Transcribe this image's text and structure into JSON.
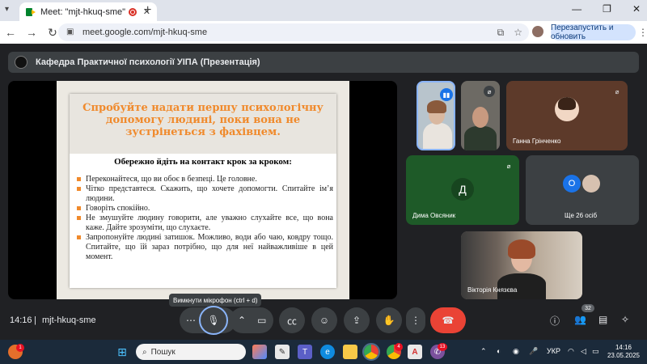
{
  "browser": {
    "tab_title": "Meet: \"mjt-hkuq-sme\"",
    "tab_close": "✕",
    "new_tab": "+",
    "url": "meet.google.com/mjt-hkuq-sme",
    "relaunch_label": "Перезапустить и обновить"
  },
  "meeting": {
    "header_title": "Кафедра Практичної психології УІПА (Презентація)",
    "time": "14:16",
    "code": "mjt-hkuq-sme",
    "mic_tooltip": "Вимкнути мікрофон (ctrl + d)",
    "participants_count": "32"
  },
  "slide": {
    "heading": "Спробуйте надати першу психологічну допомогу людині, поки вона не зустрінеться з фахівцем.",
    "subheading": "Обережно йдіть на контакт крок за кроком:",
    "bullets": [
      "Переконайтеся, що ви обоє в безпеці. Це головне.",
      "Чітко представтеся. Скажить, що хочете допомогти. Спитайте ім’я людини.",
      "Говоріть спокійно.",
      "Не змушуйте людину говорити, але уважно слухайте все, що вона каже. Дайте зрозуміти, що слухаєте.",
      "Запропонуйте людині затишок. Можливо, води або чаю, ковдру тощо. Спитайте, що їй зараз потрібно, що для неї найважливіше в цей момент."
    ],
    "accent_color": "#f08a2c"
  },
  "tiles": {
    "ganna": {
      "name": "Ганна Грінченко"
    },
    "dima": {
      "name": "Дима Овсяник",
      "initial": "Д",
      "bg": "#1e5a28"
    },
    "others": {
      "label": "Ще 26 осіб",
      "initial": "О"
    },
    "viktoriia": {
      "name": "Вікторія Князєва"
    }
  },
  "taskbar": {
    "search_placeholder": "Пошук",
    "language": "УКР",
    "time": "14:16",
    "date": "23.05.2025",
    "weather_badge": "1",
    "chrome_badge": "4",
    "viber_badge": "13"
  },
  "colors": {
    "meet_bg": "#202124",
    "control_bg": "#3c4043",
    "end_call": "#ea4335",
    "accent_blue": "#1a73e8"
  }
}
